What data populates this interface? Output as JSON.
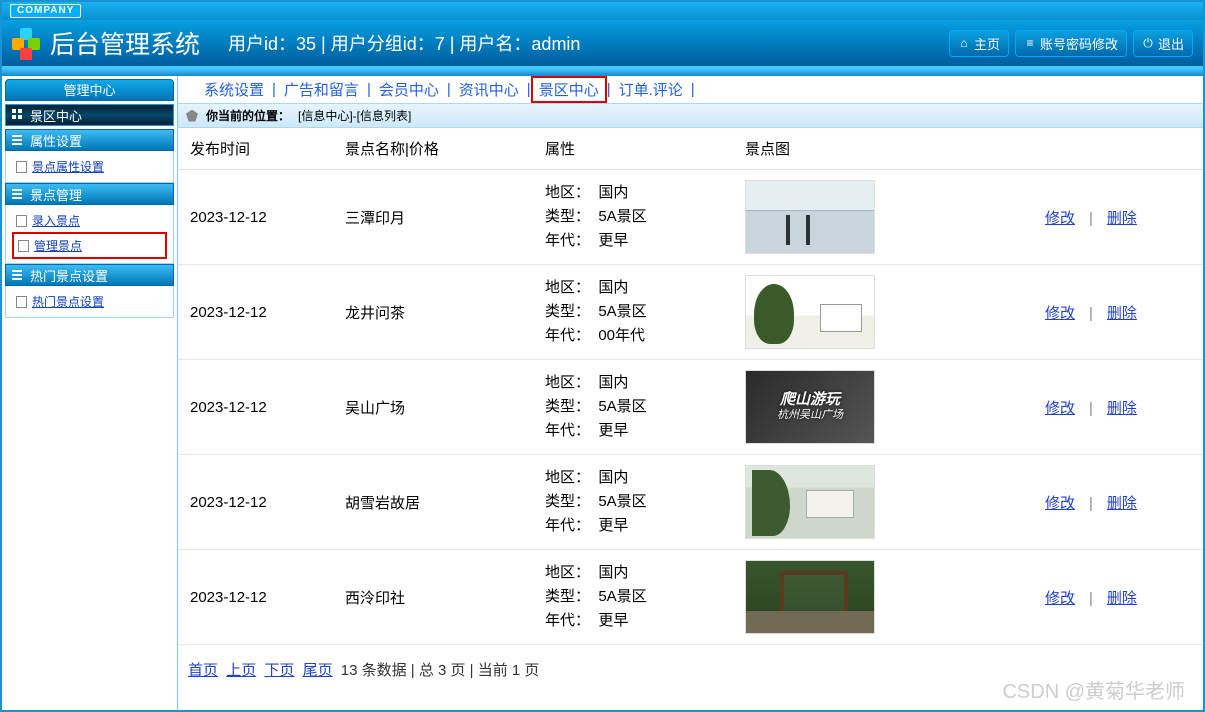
{
  "company_badge": "COMPANY",
  "app_title": "后台管理系统",
  "userbar": "用户id：35 | 用户分组id：7 | 用户名：admin",
  "header_buttons": {
    "home": "主页",
    "pwd": "账号密码修改",
    "logout": "退出"
  },
  "sidebar": {
    "title": "管理中心",
    "section_header": "景区中心",
    "groups": [
      {
        "title": "属性设置",
        "items": [
          {
            "label": "景点属性设置"
          }
        ]
      },
      {
        "title": "景点管理",
        "items": [
          {
            "label": "录入景点"
          },
          {
            "label": "管理景点",
            "highlight": true
          }
        ]
      },
      {
        "title": "热门景点设置",
        "items": [
          {
            "label": "热门景点设置"
          }
        ]
      }
    ]
  },
  "topnav": {
    "items": [
      {
        "label": "系统设置"
      },
      {
        "label": "广告和留言"
      },
      {
        "label": "会员中心"
      },
      {
        "label": "资讯中心"
      },
      {
        "label": "景区中心",
        "active": true
      },
      {
        "label": "订单.评论"
      }
    ]
  },
  "breadcrumb": {
    "prefix": "你当前的位置：",
    "trail": "[信息中心]-[信息列表]"
  },
  "table": {
    "headers": {
      "time": "发布时间",
      "name": "景点名称|价格",
      "attr": "属性",
      "img": "景点图",
      "act": ""
    },
    "attr_labels": {
      "region": "地区：",
      "type": "类型：",
      "era": "年代："
    },
    "actions": {
      "edit": "修改",
      "del": "删除"
    },
    "rows": [
      {
        "time": "2023-12-12",
        "name": "三潭印月",
        "region": "国内",
        "type": "5A景区",
        "era": "更早",
        "scene": "scene1"
      },
      {
        "time": "2023-12-12",
        "name": "龙井问茶",
        "region": "国内",
        "type": "5A景区",
        "era": "00年代",
        "scene": "scene2"
      },
      {
        "time": "2023-12-12",
        "name": "吴山广场",
        "region": "国内",
        "type": "5A景区",
        "era": "更早",
        "scene": "scene3",
        "overlay": "爬山游玩",
        "overlay_sub": "杭州吴山广场"
      },
      {
        "time": "2023-12-12",
        "name": "胡雪岩故居",
        "region": "国内",
        "type": "5A景区",
        "era": "更早",
        "scene": "scene4"
      },
      {
        "time": "2023-12-12",
        "name": "西泠印社",
        "region": "国内",
        "type": "5A景区",
        "era": "更早",
        "scene": "scene5"
      }
    ]
  },
  "pager": {
    "first": "首页",
    "prev": "上页",
    "next": "下页",
    "last": "尾页",
    "info": "13 条数据 | 总 3 页 | 当前 1 页"
  },
  "watermark": "CSDN @黄菊华老师"
}
